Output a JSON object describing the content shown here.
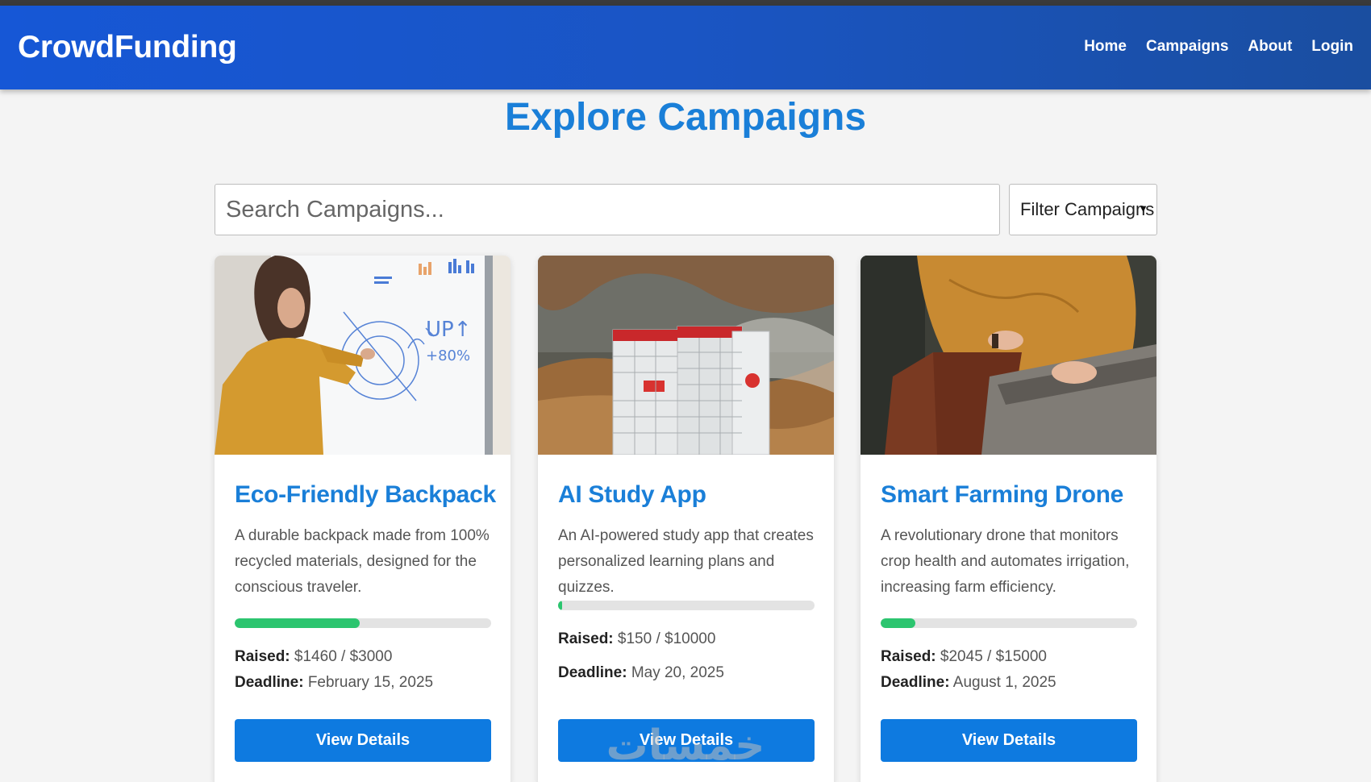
{
  "brand": "CrowdFunding",
  "nav": [
    {
      "label": "Home"
    },
    {
      "label": "Campaigns"
    },
    {
      "label": "About"
    },
    {
      "label": "Login"
    }
  ],
  "title": "Explore Campaigns",
  "search": {
    "placeholder": "Search Campaigns...",
    "value": ""
  },
  "filter": {
    "selected": "Filter Campaigns"
  },
  "colors": {
    "brand_blue": "#1657d6",
    "accent_blue": "#1a7fd8",
    "button_blue": "#0e7ae0",
    "progress_green": "#2cc56f"
  },
  "campaigns": [
    {
      "title": "Eco-Friendly Backpack",
      "description": "A durable backpack made from 100% recycled materials, designed for the conscious traveler.",
      "raised_label": "Raised:",
      "raised_value": "$1460 / $3000",
      "deadline_label": "Deadline:",
      "deadline_value": "February 15, 2025",
      "progress_fraction": 0.487,
      "button": "View Details",
      "image": "woman-drawing-on-whiteboard-photo"
    },
    {
      "title": "AI Study App",
      "description": "An AI-powered study app that creates personalized learning plans and quizzes.",
      "raised_label": "Raised:",
      "raised_value": "$150 / $10000",
      "deadline_label": "Deadline:",
      "deadline_value": "May 20, 2025",
      "progress_fraction": 0.015,
      "button": "View Details",
      "image": "parcel-lockers-photo"
    },
    {
      "title": "Smart Farming Drone",
      "description": "A revolutionary drone that monitors crop health and automates irrigation, increasing farm efficiency.",
      "raised_label": "Raised:",
      "raised_value": "$2045 / $15000",
      "deadline_label": "Deadline:",
      "deadline_value": "August 1, 2025",
      "progress_fraction": 0.136,
      "button": "View Details",
      "image": "person-typing-laptop-photo"
    }
  ],
  "watermark": "خمسات"
}
